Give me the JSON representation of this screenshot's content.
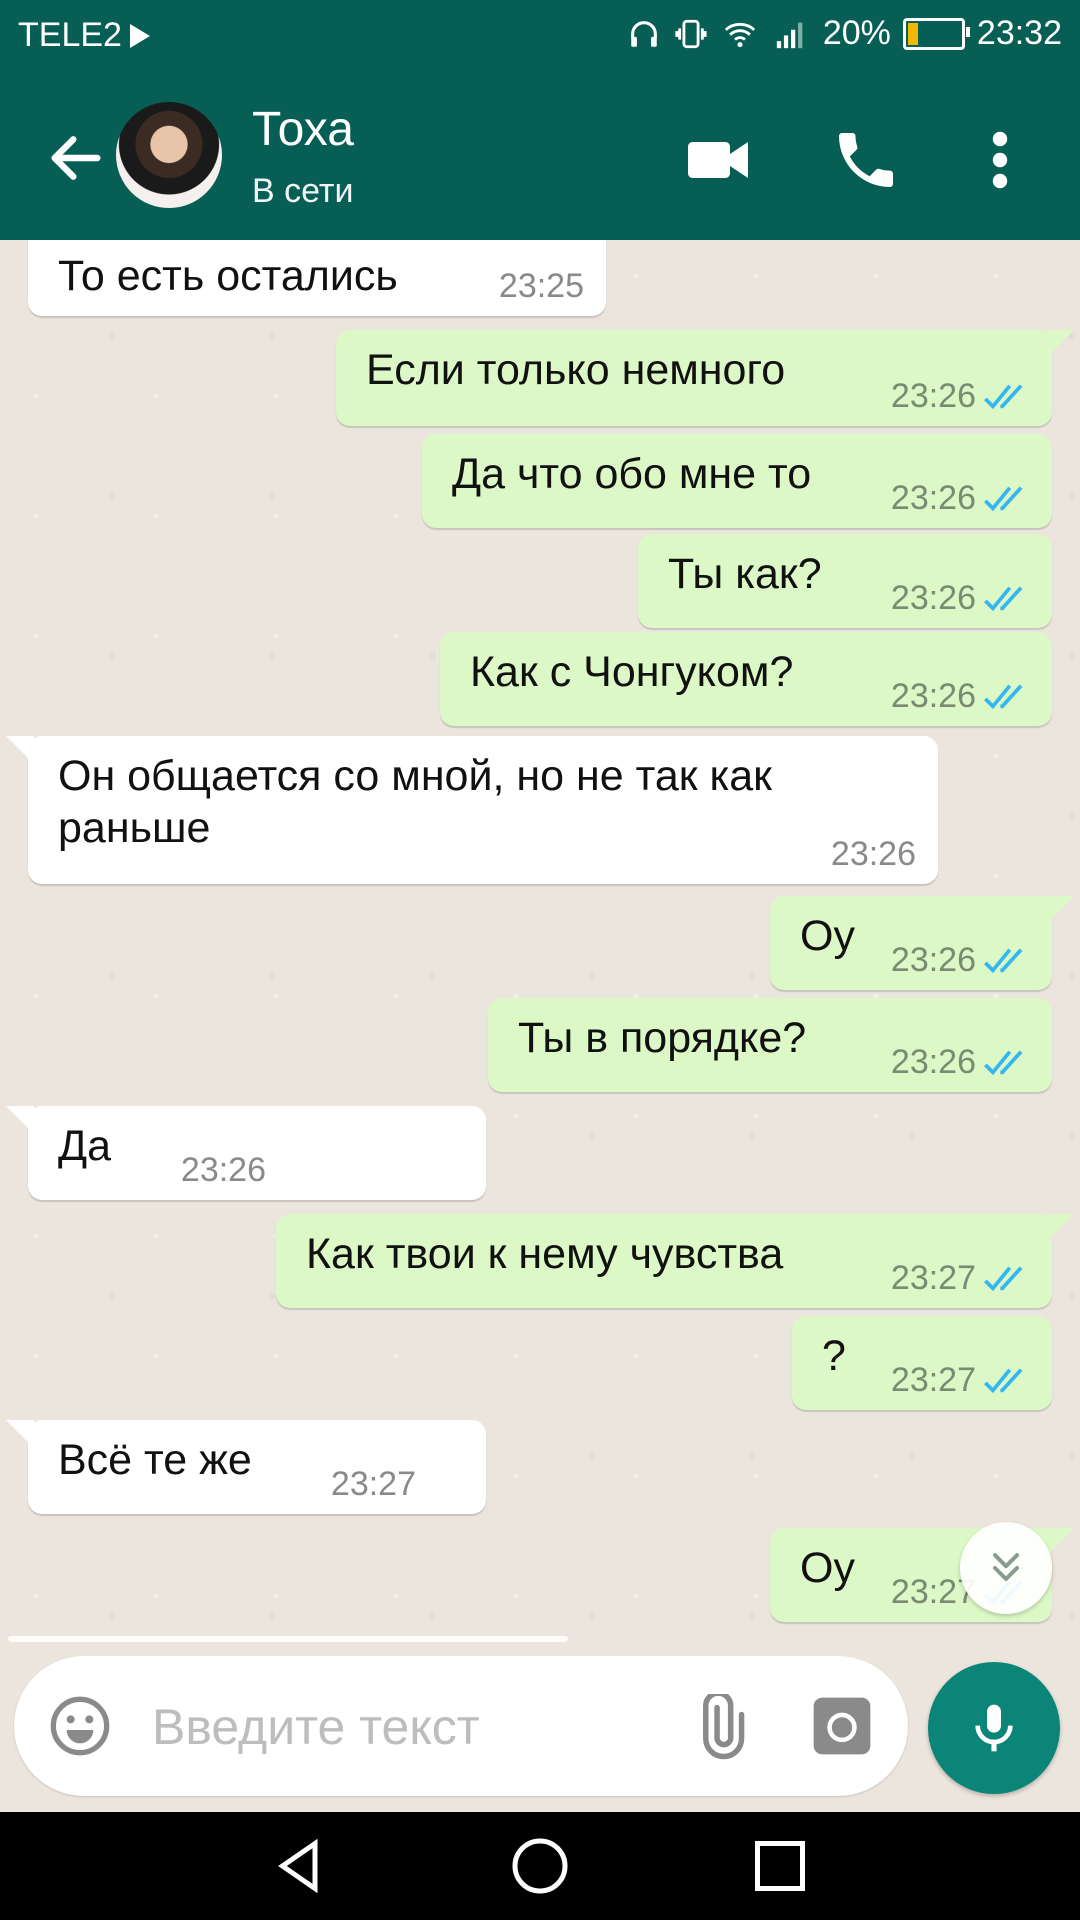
{
  "status_bar": {
    "carrier": "TELE2",
    "battery": "20%",
    "time": "23:32"
  },
  "header": {
    "contact_name": "Тоха",
    "contact_status": "В сети"
  },
  "messages": [
    {
      "dir": "in",
      "text": "То есть остались",
      "time": "23:25"
    },
    {
      "dir": "out",
      "text": "Если только немного",
      "time": "23:26"
    },
    {
      "dir": "out",
      "text": "Да что обо мне то",
      "time": "23:26"
    },
    {
      "dir": "out",
      "text": "Ты как?",
      "time": "23:26"
    },
    {
      "dir": "out",
      "text": "Как с Чонгуком?",
      "time": "23:26"
    },
    {
      "dir": "in",
      "text": "Он общается со мной, но не так как раньше",
      "time": "23:26"
    },
    {
      "dir": "out",
      "text": "Оу",
      "time": "23:26"
    },
    {
      "dir": "out",
      "text": "Ты в порядке?",
      "time": "23:26"
    },
    {
      "dir": "in",
      "text": "Да",
      "time": "23:26"
    },
    {
      "dir": "out",
      "text": "Как твои к нему чувства",
      "time": "23:27"
    },
    {
      "dir": "out",
      "text": "?",
      "time": "23:27"
    },
    {
      "dir": "in",
      "text": "Всё те же",
      "time": "23:27"
    },
    {
      "dir": "out",
      "text": "Оу",
      "time": "23:27"
    }
  ],
  "composer": {
    "placeholder": "Введите текст"
  },
  "colors": {
    "header": "#075e54",
    "outgoing_bubble": "#dcf8c6",
    "incoming_bubble": "#ffffff",
    "read_ticks": "#34b7f1",
    "mic_button": "#0a8577"
  },
  "icons": [
    "back-arrow",
    "video-camera",
    "phone",
    "more-vertical",
    "emoji",
    "paperclip",
    "camera",
    "microphone",
    "double-chevron-down",
    "nav-back",
    "nav-home",
    "nav-recents"
  ]
}
